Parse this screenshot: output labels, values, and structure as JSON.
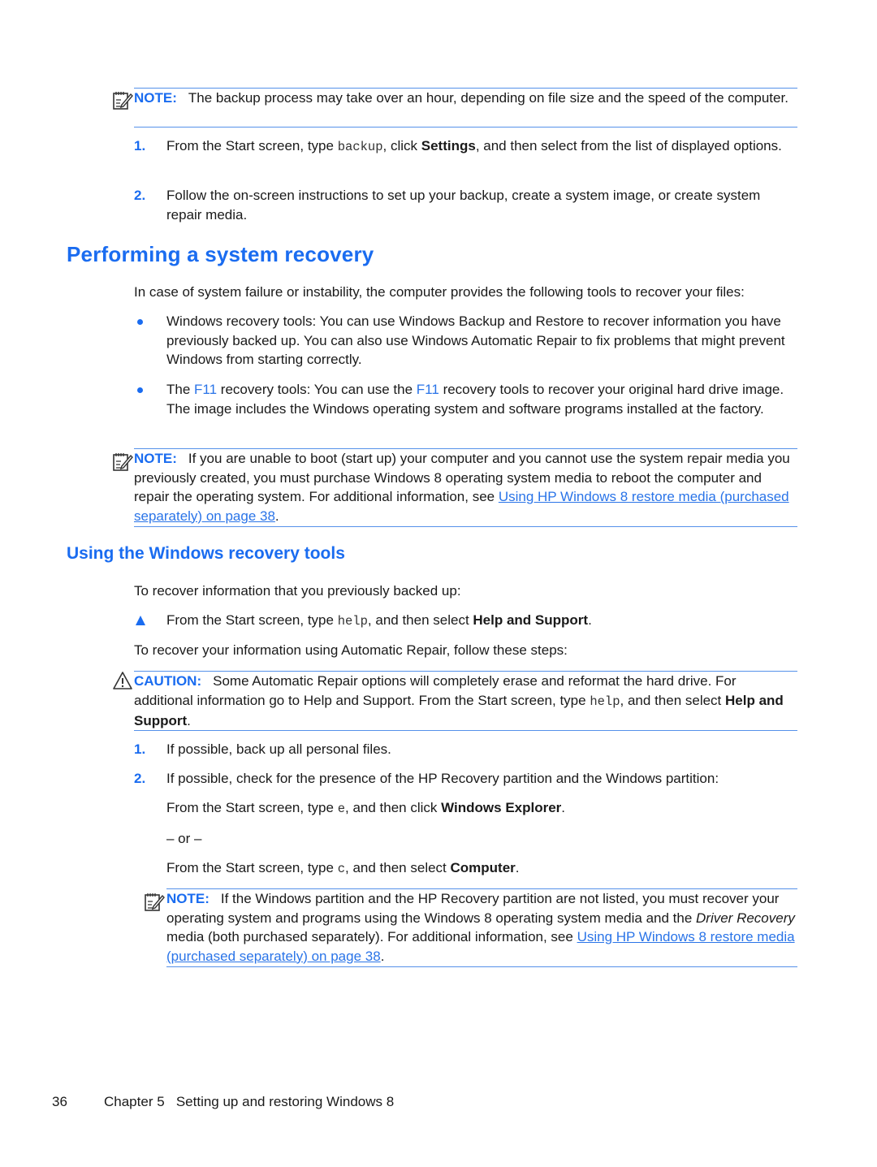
{
  "note1": {
    "label": "NOTE:",
    "text": "The backup process may take over an hour, depending on file size and the speed of the computer."
  },
  "steps_backup": [
    {
      "num": "1.",
      "pre": "From the Start screen, type ",
      "code": "backup",
      "mid": ", click ",
      "bold": "Settings",
      "post": ", and then select from the list of displayed options."
    },
    {
      "num": "2.",
      "text": "Follow the on-screen instructions to set up your backup, create a system image, or create system repair media."
    }
  ],
  "section": {
    "title": "Performing a system recovery",
    "intro": "In case of system failure or instability, the computer provides the following tools to recover your files:",
    "bullets": [
      {
        "text": "Windows recovery tools: You can use Windows Backup and Restore to recover information you have previously backed up. You can also use Windows Automatic Repair to fix problems that might prevent Windows from starting correctly."
      },
      {
        "pre": "The ",
        "key1": "F11",
        "mid": " recovery tools: You can use the ",
        "key2": "F11",
        "post": " recovery tools to recover your original hard drive image. The image includes the Windows operating system and software programs installed at the factory."
      }
    ]
  },
  "note2": {
    "label": "NOTE:",
    "text": "If you are unable to boot (start up) your computer and you cannot use the system repair media you previously created, you must purchase Windows 8 operating system media to reboot the computer and repair the operating system. For additional information, see ",
    "link": "Using HP Windows 8 restore media (purchased separately) on page 38",
    "post": "."
  },
  "subsection": {
    "title": "Using the Windows recovery tools",
    "intro": "To recover information that you previously backed up:",
    "tri_item": {
      "pre": "From the Start screen, type ",
      "code": "help",
      "mid": ", and then select ",
      "bold": "Help and Support",
      "post": "."
    },
    "intro2": "To recover your information using Automatic Repair, follow these steps:"
  },
  "caution": {
    "label": "CAUTION:",
    "text": "Some Automatic Repair options will completely erase and reformat the hard drive. For additional information go to Help and Support. From the Start screen, type ",
    "code": "help",
    "mid": ", and then select ",
    "bold": "Help and Support",
    "post": "."
  },
  "steps_repair": [
    {
      "num": "1.",
      "text": "If possible, back up all personal files."
    },
    {
      "num": "2.",
      "text": "If possible, check for the presence of the HP Recovery partition and the Windows partition:"
    }
  ],
  "sub_steps": {
    "a": {
      "pre": "From the Start screen, type ",
      "code": "e",
      "mid": ", and then click ",
      "bold": "Windows Explorer",
      "post": "."
    },
    "or": "– or –",
    "b": {
      "pre": "From the Start screen, type ",
      "code": "c",
      "mid": ", and then select ",
      "bold": "Computer",
      "post": "."
    }
  },
  "note3": {
    "label": "NOTE:",
    "text": "If the Windows partition and the HP Recovery partition are not listed, you must recover your operating system and programs using the Windows 8 operating system media and the ",
    "italic1": "Driver Recovery",
    "mid": " media (both purchased separately). For additional information, see ",
    "link": "Using HP Windows 8 restore media (purchased separately) on page 38",
    "post": "."
  },
  "footer": {
    "page_number": "36",
    "chapter": "Chapter 5   Setting up and restoring Windows 8"
  },
  "colors": {
    "accent": "#1a6cf0",
    "rule": "#5591ea",
    "text": "#1a1a1a"
  }
}
